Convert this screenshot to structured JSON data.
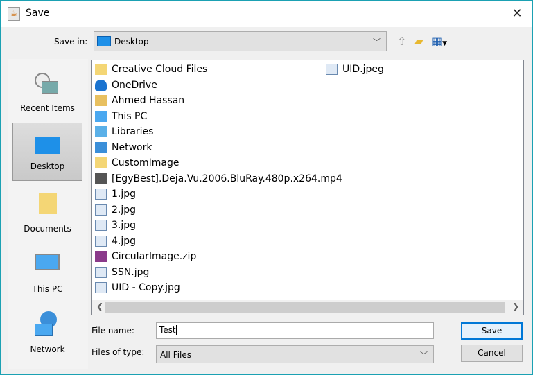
{
  "window": {
    "title": "Save",
    "close_icon": "close-icon"
  },
  "toolbar": {
    "save_in_label": "Save in:",
    "save_in_value": "Desktop",
    "icons": [
      "up-folder-icon",
      "new-folder-icon",
      "view-menu-icon"
    ]
  },
  "sidebar": {
    "items": [
      {
        "label": "Recent Items",
        "icon": "recent-items-icon"
      },
      {
        "label": "Desktop",
        "icon": "desktop-icon",
        "selected": true
      },
      {
        "label": "Documents",
        "icon": "documents-icon"
      },
      {
        "label": "This PC",
        "icon": "computer-icon"
      },
      {
        "label": "Network",
        "icon": "network-icon"
      }
    ]
  },
  "files": [
    {
      "name": "Creative Cloud Files",
      "icon": "folder-icon"
    },
    {
      "name": "OneDrive",
      "icon": "cloud-icon"
    },
    {
      "name": "Ahmed Hassan",
      "icon": "user-folder-icon"
    },
    {
      "name": "This PC",
      "icon": "computer-icon"
    },
    {
      "name": "Libraries",
      "icon": "libraries-icon"
    },
    {
      "name": "Network",
      "icon": "network-icon"
    },
    {
      "name": "CustomImage",
      "icon": "folder-icon"
    },
    {
      "name": "[EgyBest].Deja.Vu.2006.BluRay.480p.x264.mp4",
      "icon": "video-file-icon"
    },
    {
      "name": "1.jpg",
      "icon": "image-file-icon"
    },
    {
      "name": "2.jpg",
      "icon": "image-file-icon"
    },
    {
      "name": "3.jpg",
      "icon": "image-file-icon"
    },
    {
      "name": "4.jpg",
      "icon": "image-file-icon"
    },
    {
      "name": "CircularImage.zip",
      "icon": "archive-file-icon"
    },
    {
      "name": "SSN.jpg",
      "icon": "image-file-icon"
    },
    {
      "name": "UID - Copy.jpg",
      "icon": "image-file-icon"
    },
    {
      "name": "UID.jpeg",
      "icon": "image-file-icon"
    }
  ],
  "form": {
    "file_name_label": "File name:",
    "file_name_value": "Test",
    "file_type_label": "Files of type:",
    "file_type_value": "All Files"
  },
  "buttons": {
    "save": "Save",
    "cancel": "Cancel"
  }
}
